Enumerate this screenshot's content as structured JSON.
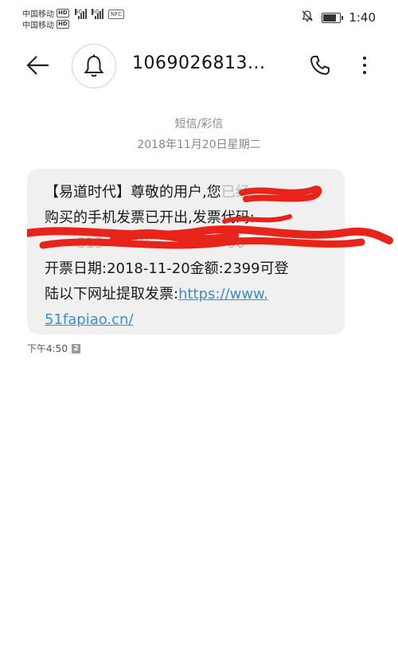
{
  "status_bar": {
    "carrier1": "中国移动",
    "carrier2": "中国移动",
    "hd": "HD",
    "net1": "4G",
    "net2": "4G",
    "nfc": "NFC",
    "time": "1:40",
    "battery_level": 0.85,
    "icons": [
      "mute-icon",
      "battery-icon"
    ]
  },
  "header": {
    "contact": "1069026813...",
    "icons": [
      "back-arrow-icon",
      "bell-icon",
      "phone-icon",
      "more-icon"
    ]
  },
  "thread": {
    "message_type": "短信/彩信",
    "date": "2018年11月20日星期二"
  },
  "message": {
    "line1": "【易道时代】尊敬的用户,您",
    "line1_tail": "已经",
    "line2": "购买的手机发票已开出,发票代码:",
    "line3": "",
    "line4": "开票日期:2018-11-20金额:2399可登",
    "line5_text": "陆以下网址提取发票:",
    "link": "https://www.51fapiao.cn/",
    "link_part1": "https://www.",
    "link_part2": "51fapiao.cn/",
    "time": "下午4:50",
    "sim": "2"
  },
  "colors": {
    "bubble": "#f0f0f0",
    "link": "#3a8fc9",
    "redaction": "#e8231a"
  }
}
